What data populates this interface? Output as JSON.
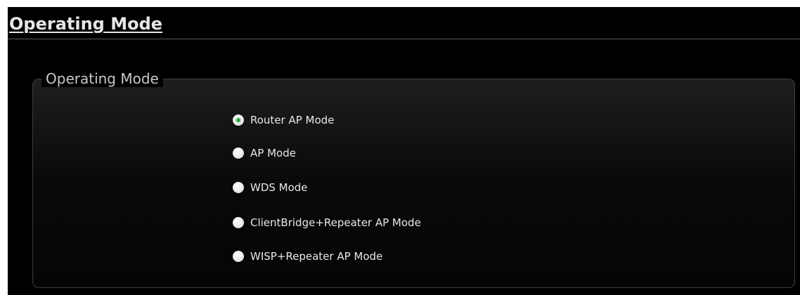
{
  "page": {
    "title": "Operating Mode"
  },
  "operating_mode_group": {
    "legend": "Operating Mode",
    "selected_index": 0,
    "options": [
      {
        "label": "Router AP Mode",
        "checked": true
      },
      {
        "label": "AP Mode",
        "checked": false
      },
      {
        "label": "WDS Mode",
        "checked": false
      },
      {
        "label": "ClientBridge+Repeater AP Mode",
        "checked": false
      },
      {
        "label": "WISP+Repeater AP Mode",
        "checked": false
      }
    ]
  },
  "colors": {
    "background": "#000000",
    "text": "#e8e8e8",
    "legend_text": "#c8c8c8",
    "radio_selected_dot": "#2fa84a",
    "group_border": "#3e3e3e"
  },
  "icons": {
    "radio_checked": "radio-checked-icon",
    "radio_unchecked": "radio-unchecked-icon"
  }
}
